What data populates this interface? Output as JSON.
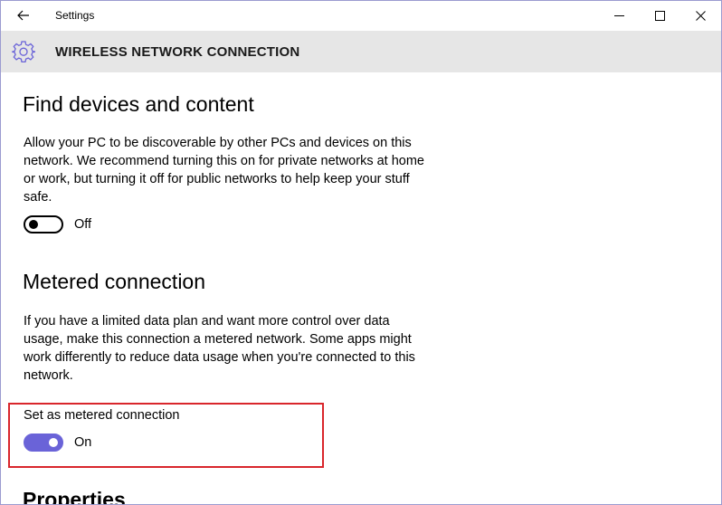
{
  "window": {
    "title": "Settings",
    "accent_color": "#6a63d8",
    "highlight_color": "#d9262c"
  },
  "titlebar": {
    "back_icon": "back-arrow-icon",
    "minimize_icon": "minimize-icon",
    "maximize_icon": "maximize-icon",
    "close_icon": "close-icon"
  },
  "header": {
    "icon": "gear-icon",
    "title": "WIRELESS NETWORK CONNECTION"
  },
  "find_devices": {
    "title": "Find devices and content",
    "description": "Allow your PC to be discoverable by other PCs and devices on this network. We recommend turning this on for private networks at home or work, but turning it off for public networks to help keep your stuff safe.",
    "toggle_state": "Off"
  },
  "metered": {
    "title": "Metered connection",
    "description": "If you have a limited data plan and want more control over data usage, make this connection a metered network. Some apps might work differently to reduce data usage when you're connected to this network.",
    "setting_label": "Set as metered connection",
    "toggle_state": "On"
  },
  "properties": {
    "title": "Properties"
  }
}
